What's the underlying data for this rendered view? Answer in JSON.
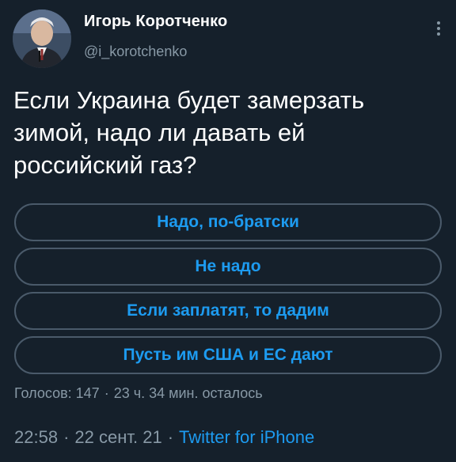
{
  "author": {
    "name": "Игорь Коротченко",
    "handle": "@i_korotchenko",
    "avatar_icon": "profile-photo"
  },
  "tweet": {
    "lines": [
      "Если Украина будет замерзать",
      "зимой, надо ли давать ей",
      "российский газ?"
    ]
  },
  "poll": {
    "options": [
      "Надо, по-братски",
      "Не надо",
      "Если заплатят, то дадим",
      "Пусть им США и ЕС дают"
    ],
    "votes": "Голосов: 147",
    "separator": "·",
    "time_left": "23 ч. 34 мин. осталось"
  },
  "meta": {
    "time": "22:58",
    "separator": "·",
    "date": "22 сент. 21",
    "source": "Twitter for iPhone"
  },
  "colors": {
    "background": "#15202b",
    "accent": "#1d9bf0",
    "secondary_text": "#8899a6",
    "border": "#4a5a6a"
  },
  "icons": {
    "more": "more-vertical-icon"
  }
}
